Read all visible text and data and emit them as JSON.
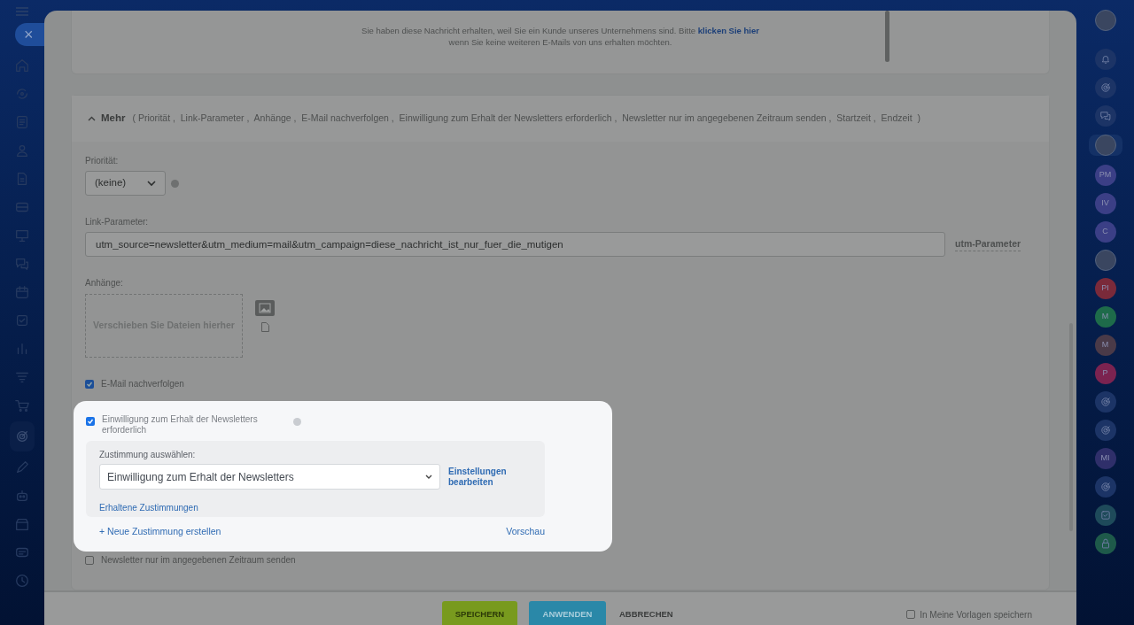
{
  "left_nav": [
    {
      "kind": "home",
      "selected": false
    },
    {
      "kind": "sync",
      "selected": false
    },
    {
      "kind": "news",
      "selected": false
    },
    {
      "kind": "users",
      "selected": false
    },
    {
      "kind": "file",
      "selected": false
    },
    {
      "kind": "card",
      "selected": false
    },
    {
      "kind": "board",
      "selected": false
    },
    {
      "kind": "chat",
      "selected": false
    },
    {
      "kind": "calendar",
      "selected": false
    },
    {
      "kind": "task",
      "selected": false
    },
    {
      "kind": "chart",
      "selected": false
    },
    {
      "kind": "filter",
      "selected": false
    },
    {
      "kind": "cart",
      "selected": false
    },
    {
      "kind": "target",
      "selected": true
    },
    {
      "kind": "pen",
      "selected": false
    },
    {
      "kind": "robot",
      "selected": false
    },
    {
      "kind": "store",
      "selected": false
    },
    {
      "kind": "message",
      "selected": false
    },
    {
      "kind": "clock",
      "selected": false
    }
  ],
  "close_button": "×",
  "email_footer": {
    "text": "Sie haben diese Nachricht erhalten, weil Sie ein Kunde unseres Unternehmens sind. Bitte",
    "link": "klicken Sie hier",
    "text_after": "wenn Sie keine weiteren E-Mails von uns erhalten möchten."
  },
  "more_section": {
    "toggle": "Mehr",
    "expanded": true,
    "summary": "( Priorität ,  Link-Parameter ,  Anhänge ,  E-Mail nachverfolgen ,  Einwilligung zum Erhalt der Newsletters erforderlich ,  Newsletter nur im angegebenen Zeitraum senden ,  Startzeit ,  Endzeit  )"
  },
  "priority": {
    "label": "Priorität:",
    "value": "(keine)"
  },
  "link_params": {
    "label": "Link-Parameter:",
    "value": "utm_source=newsletter&utm_medium=mail&utm_campaign=diese_nachricht_ist_nur_fuer_die_mutigen",
    "link": "utm-Parameter"
  },
  "attachments": {
    "label": "Anhänge:",
    "dropzone": "Verschieben Sie Dateien hierher"
  },
  "track_email": {
    "label": "E-Mail nachverfolgen",
    "checked": true
  },
  "consent": {
    "label": "Einwilligung zum Erhalt der Newsletters erforderlich",
    "checked": true,
    "select_label": "Zustimmung auswählen:",
    "select_value": "Einwilligung zum Erhalt der Newsletters",
    "edit_link": "Einstellungen bearbeiten",
    "received_link": "Erhaltene Zustimmungen",
    "create_link": "+ Neue Zustimmung erstellen",
    "preview_link": "Vorschau"
  },
  "time_window": {
    "label": "Newsletter nur im angegebenen Zeitraum senden",
    "checked": false
  },
  "footer": {
    "buttons": [
      {
        "kind": "save",
        "label": "SPEICHERN"
      },
      {
        "kind": "apply",
        "label": "ANWENDEN"
      },
      {
        "kind": "cancel",
        "label": "ABBRECHEN"
      }
    ],
    "template": {
      "label": "In Meine Vorlagen speichern",
      "checked": false
    }
  },
  "right_bar": [
    {
      "kind": "photo",
      "selected": false
    },
    {
      "kind": "bell",
      "selected": false
    },
    {
      "kind": "target",
      "selected": false
    },
    {
      "kind": "chat",
      "selected": false
    },
    {
      "kind": "photo",
      "selected": true
    },
    {
      "kind": "initials",
      "text": "PM",
      "color": "#3b3f86",
      "selected": false
    },
    {
      "kind": "initials",
      "text": "IV",
      "color": "#3b3f86",
      "selected": false
    },
    {
      "kind": "initials",
      "text": "C",
      "color": "#3b3f86",
      "selected": false
    },
    {
      "kind": "photo",
      "selected": false
    },
    {
      "kind": "initials",
      "text": "PI",
      "color": "#7a2a3a",
      "selected": false
    },
    {
      "kind": "initials",
      "text": "M",
      "color": "#1e6b4a",
      "selected": false
    },
    {
      "kind": "initials",
      "text": "M",
      "color": "#4a3a48",
      "selected": false
    },
    {
      "kind": "initials",
      "text": "P",
      "color": "#7b2350",
      "selected": false
    },
    {
      "kind": "target",
      "selected": false
    },
    {
      "kind": "target",
      "selected": false
    },
    {
      "kind": "initials",
      "text": "MI",
      "color": "#2f2f6a",
      "selected": false
    },
    {
      "kind": "target",
      "selected": false
    },
    {
      "kind": "task",
      "selected": false
    },
    {
      "kind": "lock",
      "selected": false
    }
  ]
}
